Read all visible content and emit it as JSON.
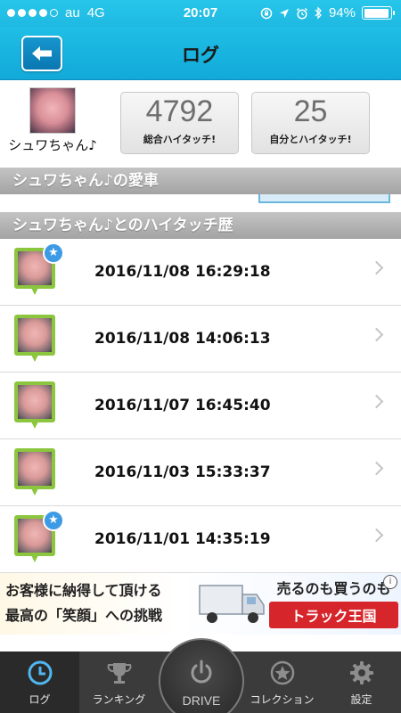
{
  "status_bar": {
    "carrier": "au",
    "network": "4G",
    "time": "20:07",
    "battery": "94%",
    "battery_level": 0.94
  },
  "nav": {
    "title": "ログ",
    "back_icon": "back-arrow-icon"
  },
  "profile": {
    "name": "シュワちゃん♪",
    "stats": [
      {
        "value": "4792",
        "label": "総合ハイタッチ!"
      },
      {
        "value": "25",
        "label": "自分とハイタッチ!"
      }
    ]
  },
  "sections": {
    "car": "シュワちゃん♪の愛車",
    "history": "シュワちゃん♪とのハイタッチ歴"
  },
  "log_items": [
    {
      "datetime": "2016/11/08 16:29:18",
      "starred": true
    },
    {
      "datetime": "2016/11/08 14:06:13",
      "starred": false
    },
    {
      "datetime": "2016/11/07 16:45:40",
      "starred": false
    },
    {
      "datetime": "2016/11/03 15:33:37",
      "starred": false
    },
    {
      "datetime": "2016/11/01 14:35:19",
      "starred": true
    }
  ],
  "ad": {
    "line1": "お客様に納得して頂ける",
    "line2": "最高の「笑顔」への挑戦",
    "right_top": "売るのも買うのも",
    "brand": "トラック王国",
    "info": "i"
  },
  "tabs": [
    {
      "label": "ログ",
      "icon": "clock-icon",
      "active": true
    },
    {
      "label": "ランキング",
      "icon": "trophy-icon",
      "active": false
    },
    {
      "label": "DRIVE",
      "icon": "power-icon",
      "active": false
    },
    {
      "label": "コレクション",
      "icon": "star-badge-icon",
      "active": false
    },
    {
      "label": "設定",
      "icon": "gear-icon",
      "active": false
    }
  ],
  "colors": {
    "header_blue": "#1fb9e2",
    "pin_green": "#8cc63e",
    "star_blue": "#3d9be6",
    "tabbar": "#3b3b3b"
  }
}
